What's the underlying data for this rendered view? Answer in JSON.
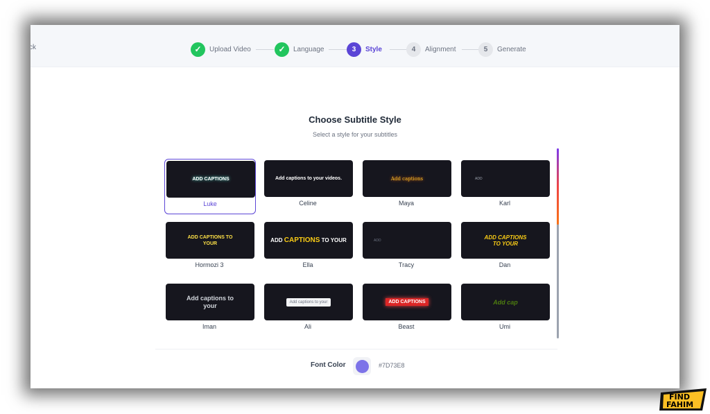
{
  "nav": {
    "back_text": "ck"
  },
  "steps": [
    {
      "num": "✓",
      "label": "Upload Video",
      "state": "done"
    },
    {
      "num": "✓",
      "label": "Language",
      "state": "done"
    },
    {
      "num": "3",
      "label": "Style",
      "state": "active"
    },
    {
      "num": "4",
      "label": "Alignment",
      "state": "todo"
    },
    {
      "num": "5",
      "label": "Generate",
      "state": "todo"
    }
  ],
  "main": {
    "title": "Choose Subtitle Style",
    "subtitle": "Select a style for your subtitles"
  },
  "styles": [
    {
      "name": "Luke",
      "preview": "ADD CAPTIONS",
      "selected": true
    },
    {
      "name": "Celine",
      "preview": "Add captions to your videos."
    },
    {
      "name": "Maya",
      "preview": "Add captions"
    },
    {
      "name": "Karl",
      "preview": "ADD"
    },
    {
      "name": "Hormozi 3",
      "preview": "ADD CAPTIONS TO YOUR"
    },
    {
      "name": "Ella",
      "preview_parts": [
        "ADD",
        "CAPTIONS",
        "TO YOUR"
      ]
    },
    {
      "name": "Tracy",
      "preview": "ADD"
    },
    {
      "name": "Dan",
      "preview": "ADD CAPTIONS TO YOUR"
    },
    {
      "name": "Iman",
      "preview": "Add captions to your"
    },
    {
      "name": "Ali",
      "preview": "Add captions to your"
    },
    {
      "name": "Beast",
      "preview": "ADD CAPTIONS"
    },
    {
      "name": "Umi",
      "preview": "Add cap"
    }
  ],
  "font_color": {
    "label": "Font Color",
    "value": "#7D73E8"
  },
  "watermark": {
    "line1": "FIND",
    "line2": "FAHIM"
  },
  "colors": {
    "accent": "#5b45d6",
    "done": "#22c55e",
    "thumb_bg": "#16161e"
  }
}
